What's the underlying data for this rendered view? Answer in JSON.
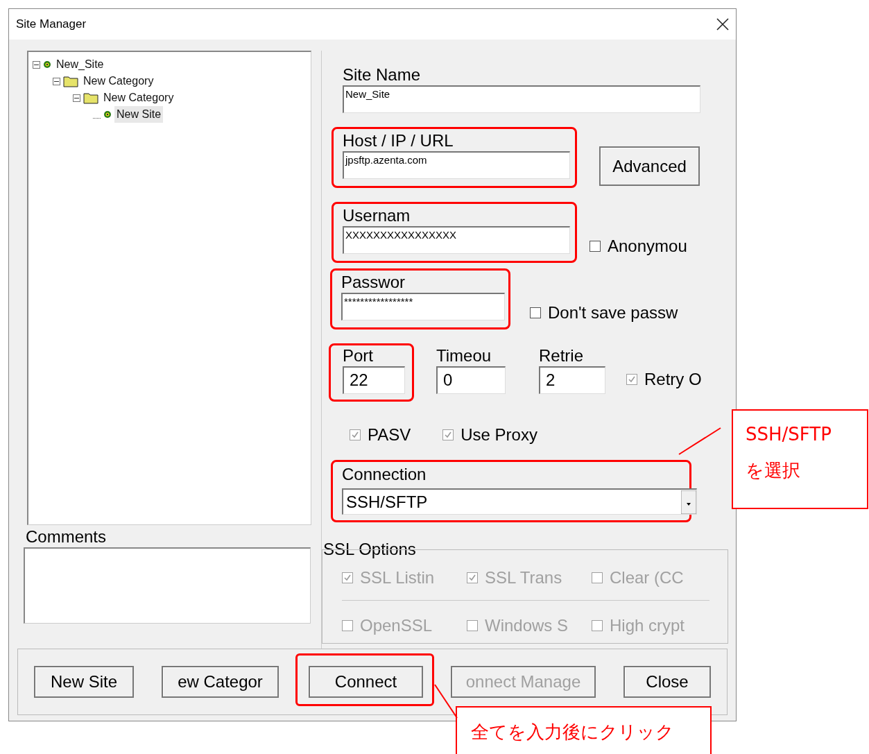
{
  "window": {
    "title": "Site Manager"
  },
  "tree": [
    {
      "label": "New_Site",
      "kind": "site",
      "selected": false,
      "expanded": true,
      "children": [
        {
          "label": "New Category",
          "kind": "folder",
          "selected": false,
          "expanded": true,
          "children": [
            {
              "label": "New Category",
              "kind": "folder",
              "selected": false,
              "expanded": true,
              "children": [
                {
                  "label": "New Site",
                  "kind": "site",
                  "selected": true
                }
              ]
            }
          ]
        }
      ]
    }
  ],
  "comments": {
    "label": "Comments"
  },
  "site_name": {
    "label": "Site Name",
    "value": "New_Site"
  },
  "host": {
    "label": "Host / IP / URL",
    "value": "jpsftp.azenta.com"
  },
  "advanced_button": "Advanced",
  "username": {
    "label": "Usernam",
    "value": "XXXXXXXXXXXXXXXX"
  },
  "anonymous": {
    "label": "Anonymou",
    "checked": false,
    "disabled": false
  },
  "password": {
    "label": "Passwor",
    "value": "*****************"
  },
  "dont_save": {
    "label": "Don't save passw",
    "checked": false,
    "disabled": false
  },
  "port": {
    "label": "Port",
    "value": "22"
  },
  "timeout": {
    "label": "Timeou",
    "value": "0"
  },
  "retries": {
    "label": "Retrie",
    "value": "2"
  },
  "retry_on": {
    "label": "Retry O",
    "checked": true,
    "disabled": true
  },
  "options": [
    {
      "label": "PASV",
      "checked": true,
      "disabled": true
    },
    {
      "label": "Use Proxy",
      "checked": true,
      "disabled": true
    }
  ],
  "connection": {
    "label": "Connection",
    "value": "SSH/SFTP"
  },
  "ssl_options": {
    "label": "SSL Options",
    "rows": [
      [
        {
          "label": "SSL Listin",
          "checked": true,
          "disabled": true
        },
        {
          "label": "SSL Trans",
          "checked": true,
          "disabled": true
        },
        {
          "label": "Clear (CC",
          "checked": false,
          "disabled": true
        }
      ],
      [
        {
          "label": "OpenSSL",
          "checked": false,
          "disabled": true
        },
        {
          "label": "Windows S",
          "checked": false,
          "disabled": true
        },
        {
          "label": "High crypt",
          "checked": false,
          "disabled": true
        }
      ]
    ]
  },
  "buttons": [
    {
      "label": "New Site",
      "disabled": false
    },
    {
      "label": "ew Categor",
      "disabled": false
    },
    {
      "label": "Connect",
      "disabled": false
    },
    {
      "label": "onnect Manage",
      "disabled": true
    },
    {
      "label": "Close",
      "disabled": false
    }
  ],
  "annotations": [
    {
      "lines": [
        "SSH/SFTP",
        "を選択"
      ]
    },
    {
      "lines": [
        "全てを入力後にクリック"
      ]
    }
  ]
}
